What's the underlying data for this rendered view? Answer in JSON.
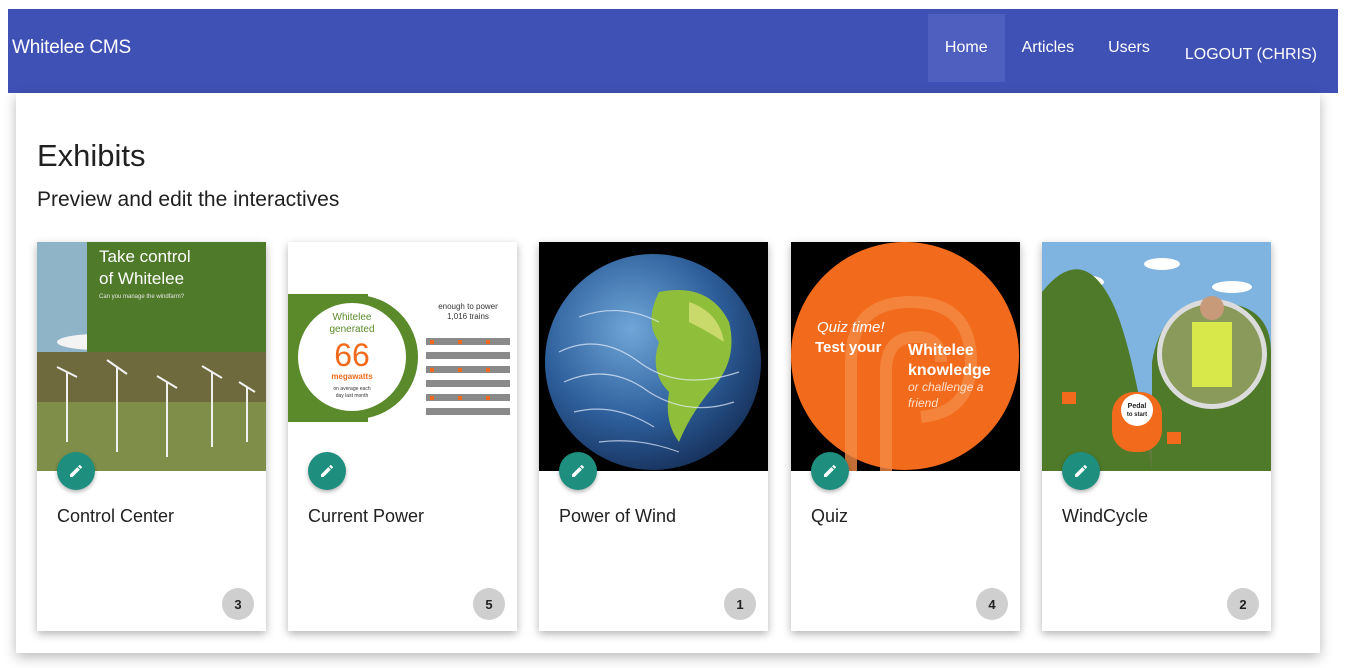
{
  "appbar": {
    "brand": "Whitelee CMS",
    "nav": [
      {
        "label": "Home",
        "active": true
      },
      {
        "label": "Articles",
        "active": false
      },
      {
        "label": "Users",
        "active": false
      }
    ],
    "logout_label": "LOGOUT (CHRIS)",
    "color": "#3f51b5"
  },
  "page": {
    "title": "Exhibits",
    "subtitle": "Preview and edit the interactives"
  },
  "cards": [
    {
      "title": "Control Center",
      "count": "3",
      "image": {
        "heading_line1": "Take control",
        "heading_line2": "of Whitelee",
        "caption": "Can you manage the windfarm?"
      }
    },
    {
      "title": "Current Power",
      "count": "5",
      "image": {
        "line1": "Whitelee",
        "line2": "generated",
        "value": "66",
        "unit": "megawatts",
        "note1": "on average each",
        "note2": "day last month",
        "right1": "enough to power",
        "right2": "1,016 trains"
      }
    },
    {
      "title": "Power of Wind",
      "count": "1",
      "image": {}
    },
    {
      "title": "Quiz",
      "count": "4",
      "image": {
        "line1": "Quiz time!",
        "line2a": "Test your",
        "line2b": "Whitelee",
        "line3": "knowledge",
        "line4": "or challenge a",
        "line5": "friend"
      }
    },
    {
      "title": "WindCycle",
      "count": "2",
      "image": {
        "line1": "Pedal",
        "line2": "to start"
      }
    }
  ],
  "colors": {
    "accent_teal": "#1e8f7f",
    "whitelee_green": "#5b8a2a",
    "orange": "#f26a1b"
  }
}
